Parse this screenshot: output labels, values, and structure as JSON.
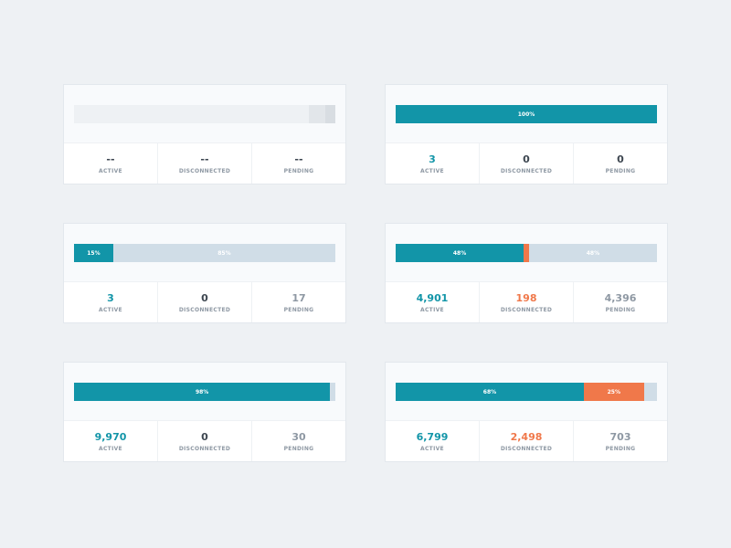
{
  "colors": {
    "active": "#1295a8",
    "disconnected": "#f0784a",
    "pending": "#d0dde7",
    "neutral_text": "#3d4650",
    "muted_text": "#8e98a3",
    "empty_track": "#eef1f4",
    "empty_tail": "#e2e6ea",
    "empty_end": "#d8dde2"
  },
  "labels": {
    "active": "ACTIVE",
    "disconnected": "DISCONNECTED",
    "pending": "PENDING"
  },
  "cards": [
    {
      "bar": [
        {
          "kind": "empty_track",
          "fraction": 0.9,
          "label": ""
        },
        {
          "kind": "empty_tail",
          "fraction": 0.06,
          "label": ""
        },
        {
          "kind": "empty_end",
          "fraction": 0.04,
          "label": ""
        }
      ],
      "stats": [
        {
          "value": "--",
          "tone": "neutral_text"
        },
        {
          "value": "--",
          "tone": "neutral_text"
        },
        {
          "value": "--",
          "tone": "neutral_text"
        }
      ]
    },
    {
      "bar": [
        {
          "kind": "active",
          "fraction": 1.0,
          "label": "100%"
        }
      ],
      "stats": [
        {
          "value": "3",
          "tone": "active"
        },
        {
          "value": "0",
          "tone": "neutral_text"
        },
        {
          "value": "0",
          "tone": "neutral_text"
        }
      ]
    },
    {
      "bar": [
        {
          "kind": "active",
          "fraction": 0.15,
          "label": "15%"
        },
        {
          "kind": "pending",
          "fraction": 0.85,
          "label": "85%"
        }
      ],
      "stats": [
        {
          "value": "3",
          "tone": "active"
        },
        {
          "value": "0",
          "tone": "neutral_text"
        },
        {
          "value": "17",
          "tone": "muted_text"
        }
      ]
    },
    {
      "bar": [
        {
          "kind": "active",
          "fraction": 0.49,
          "label": "48%"
        },
        {
          "kind": "disconnected",
          "fraction": 0.02,
          "label": ""
        },
        {
          "kind": "pending",
          "fraction": 0.49,
          "label": "48%"
        }
      ],
      "stats": [
        {
          "value": "4,901",
          "tone": "active"
        },
        {
          "value": "198",
          "tone": "disconnected"
        },
        {
          "value": "4,396",
          "tone": "muted_text"
        }
      ]
    },
    {
      "bar": [
        {
          "kind": "active",
          "fraction": 0.98,
          "label": "98%"
        },
        {
          "kind": "pending",
          "fraction": 0.02,
          "label": ""
        }
      ],
      "stats": [
        {
          "value": "9,970",
          "tone": "active"
        },
        {
          "value": "0",
          "tone": "neutral_text"
        },
        {
          "value": "30",
          "tone": "muted_text"
        }
      ]
    },
    {
      "bar": [
        {
          "kind": "active",
          "fraction": 0.72,
          "label": "68%"
        },
        {
          "kind": "disconnected",
          "fraction": 0.23,
          "label": "25%"
        },
        {
          "kind": "pending",
          "fraction": 0.05,
          "label": ""
        }
      ],
      "stats": [
        {
          "value": "6,799",
          "tone": "active"
        },
        {
          "value": "2,498",
          "tone": "disconnected"
        },
        {
          "value": "703",
          "tone": "muted_text"
        }
      ]
    }
  ]
}
